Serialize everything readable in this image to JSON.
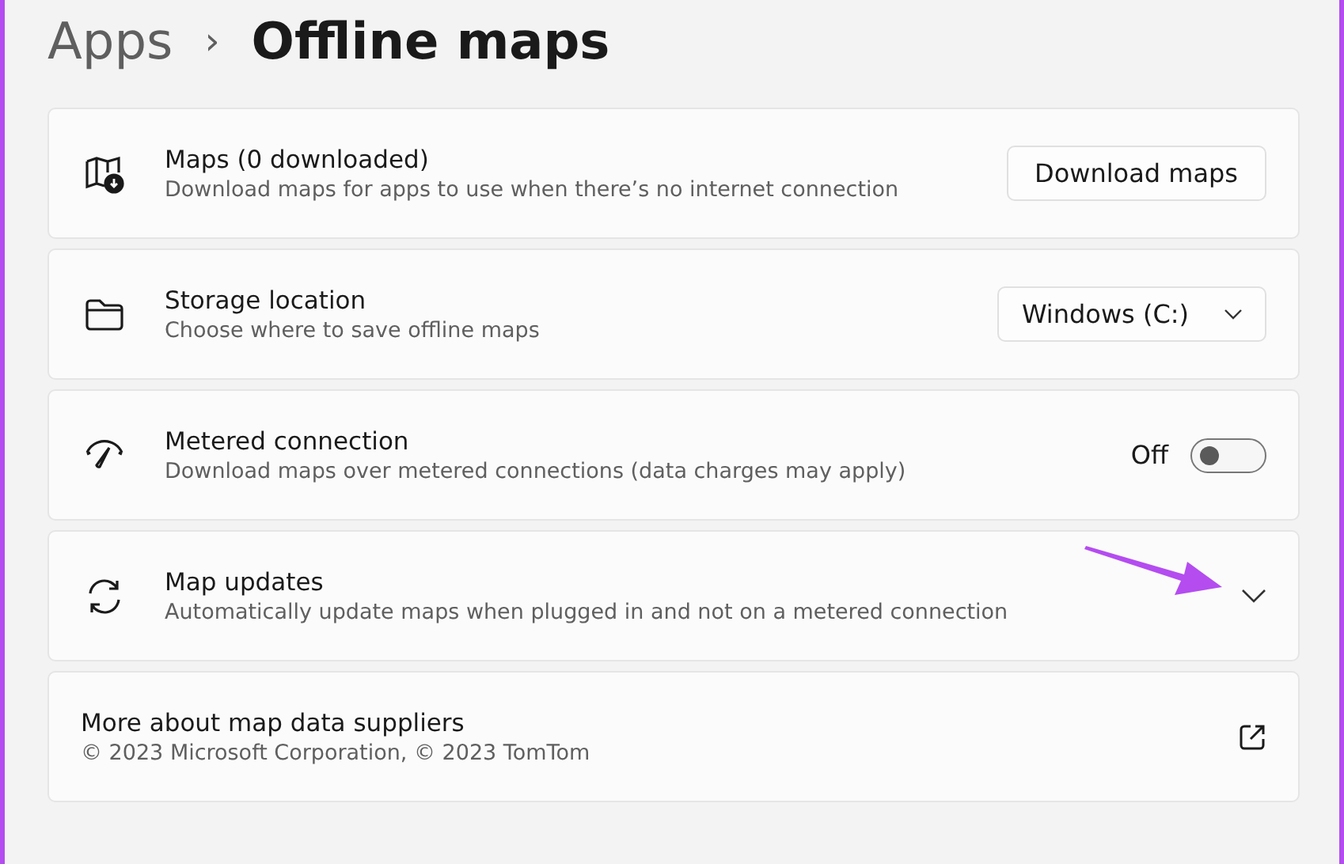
{
  "breadcrumb": {
    "parent": "Apps",
    "separator": "›",
    "current": "Offline maps"
  },
  "cards": [
    {
      "kind": "button",
      "title": "Maps (0 downloaded)",
      "description": "Download maps for apps to use when there’s no internet connection",
      "button": "Download maps"
    },
    {
      "kind": "dropdown",
      "title": "Storage location",
      "description": "Choose where to save offline maps",
      "value": "Windows (C:)"
    },
    {
      "kind": "toggle",
      "title": "Metered connection",
      "description": "Download maps over metered connections (data charges may apply)",
      "state_label": "Off",
      "on": false
    },
    {
      "kind": "expander",
      "title": "Map updates",
      "description": "Automatically update maps when plugged in and not on a metered connection",
      "expanded": false
    },
    {
      "kind": "link",
      "title": "More about map data suppliers",
      "description": "© 2023 Microsoft Corporation, © 2023 TomTom"
    }
  ]
}
